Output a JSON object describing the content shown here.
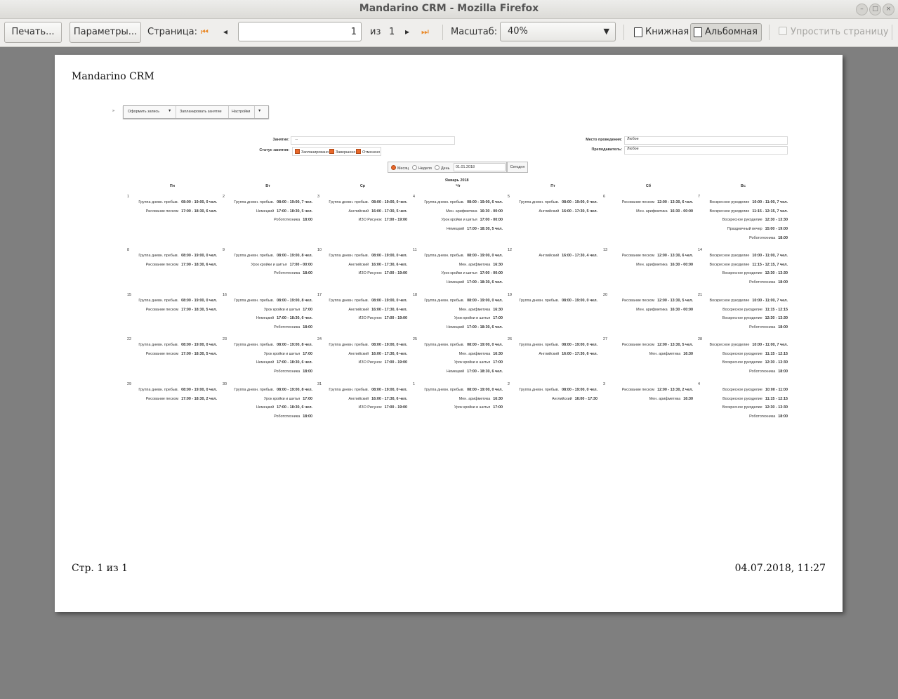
{
  "window": {
    "title": "Mandarino CRM - Mozilla Firefox"
  },
  "toolbar": {
    "print_label": "Печать...",
    "params_label": "Параметры...",
    "page_label": "Страница:",
    "page_value": "1",
    "of_label": "из",
    "total_pages": "1",
    "scale_label": "Масштаб:",
    "scale_value": "40%",
    "portrait_label": "Книжная",
    "landscape_label": "Альбомная",
    "simplify_label": "Упростить страницу",
    "active_orientation": "landscape"
  },
  "page": {
    "header": "Mandarino CRM",
    "footer_left": "Стр. 1 из 1",
    "footer_right": "04.07.2018, 11:27"
  },
  "crm": {
    "menu": {
      "back": "»",
      "create_record": "Оформить запись",
      "plan_lesson": "Запланировать занятие",
      "settings": "Настройки"
    },
    "filters": {
      "lesson_label": "Занятие:",
      "lesson_value": "...",
      "status_label": "Статус занятия:",
      "statuses": [
        "Запланировано",
        "Завершено",
        "Отменено"
      ],
      "place_label": "Место проведения:",
      "place_value": "Любое",
      "teacher_label": "Преподаватель:",
      "teacher_value": "Любое"
    },
    "view": {
      "month": "Месяц",
      "week": "Неделя",
      "day": "День",
      "date": "01.01.2018",
      "today": "Сегодня"
    },
    "calendar": {
      "month_title": "Январь 2018",
      "weekdays": [
        "Пн",
        "Вт",
        "Ср",
        "Чт",
        "Пт",
        "Сб",
        "Вс"
      ],
      "weeks": [
        [
          {
            "d": "1",
            "ev": [
              [
                "Группа дневн. пребыв.",
                "08:00 - 19:00, 0 чел."
              ],
              [
                "Рисование песком",
                "17:00 - 18:30, 6 чел."
              ]
            ]
          },
          {
            "d": "2",
            "ev": [
              [
                "Группа дневн. пребыв.",
                "08:00 - 19:00, 7 чел."
              ],
              [
                "Немецкий",
                "17:00 - 18:30, 5 чел."
              ],
              [
                "Робототехника",
                "18:00"
              ]
            ]
          },
          {
            "d": "3",
            "ev": [
              [
                "Группа дневн. пребыв.",
                "08:00 - 19:00, 0 чел."
              ],
              [
                "Английский",
                "16:00 - 17:30, 5 чел."
              ],
              [
                "ИЗО Рисунок",
                "17:00 - 19:00"
              ]
            ]
          },
          {
            "d": "4",
            "ev": [
              [
                "Группа дневн. пребыв.",
                "08:00 - 19:00, 6 чел."
              ],
              [
                "Мен. арифметика",
                "16:30 - 00:00"
              ],
              [
                "Урок кройки и шитья",
                "17:00 - 00:00"
              ],
              [
                "Немецкий",
                "17:00 - 18:30, 5 чел."
              ]
            ]
          },
          {
            "d": "5",
            "ev": [
              [
                "Группа дневн. пребыв.",
                "08:00 - 19:00, 0 чел."
              ],
              [
                "Английский",
                "16:00 - 17:30, 5 чел."
              ]
            ]
          },
          {
            "d": "6",
            "ev": [
              [
                "Рисование песком",
                "12:00 - 13:30, 6 чел."
              ],
              [
                "Мен. арифметика",
                "16:30 - 00:00"
              ]
            ]
          },
          {
            "d": "7",
            "ev": [
              [
                "Воскресное рукоделие",
                "10:00 - 11:00, 7 чел."
              ],
              [
                "Воскресное рукоделие",
                "11:15 - 12:15, 7 чел."
              ],
              [
                "Воскресное рукоделие",
                "12:30 - 13:30"
              ],
              [
                "Праздничный вечер",
                "15:00 - 19:00"
              ],
              [
                "Робототехника",
                "18:00"
              ]
            ]
          }
        ],
        [
          {
            "d": "8",
            "ev": [
              [
                "Группа дневн. пребыв.",
                "08:00 - 19:00, 0 чел."
              ],
              [
                "Рисование песком",
                "17:00 - 18:30, 6 чел."
              ]
            ]
          },
          {
            "d": "9",
            "ev": [
              [
                "Группа дневн. пребыв.",
                "08:00 - 19:00, 8 чел."
              ],
              [
                "Урок кройки и шитья",
                "17:00 - 00:00"
              ],
              [
                "Робототехника",
                "18:00"
              ]
            ]
          },
          {
            "d": "10",
            "ev": [
              [
                "Группа дневн. пребыв.",
                "08:00 - 19:00, 0 чел."
              ],
              [
                "Английский",
                "16:00 - 17:30, 6 чел."
              ],
              [
                "ИЗО Рисунок",
                "17:00 - 19:00"
              ]
            ]
          },
          {
            "d": "11",
            "ev": [
              [
                "Группа дневн. пребыв.",
                "08:00 - 19:00, 0 чел."
              ],
              [
                "Мен. арифметика",
                "16:30"
              ],
              [
                "Урок кройки и шитья",
                "17:00 - 00:00"
              ],
              [
                "Немецкий",
                "17:00 - 18:30, 6 чел."
              ]
            ]
          },
          {
            "d": "12",
            "ev": [
              [
                "Английский",
                "16:00 - 17:30, 4 чел."
              ]
            ]
          },
          {
            "d": "13",
            "ev": [
              [
                "Рисование песком",
                "12:00 - 13:30, 6 чел."
              ],
              [
                "Мен. арифметика",
                "16:30 - 00:00"
              ]
            ]
          },
          {
            "d": "14",
            "ev": [
              [
                "Воскресное рукоделие",
                "10:00 - 11:00, 7 чел."
              ],
              [
                "Воскресное рукоделие",
                "11:15 - 12:15, 7 чел."
              ],
              [
                "Воскресное рукоделие",
                "12:30 - 13:30"
              ],
              [
                "Робототехника",
                "18:00"
              ]
            ]
          }
        ],
        [
          {
            "d": "15",
            "ev": [
              [
                "Группа дневн. пребыв.",
                "08:00 - 19:00, 0 чел."
              ],
              [
                "Рисование песком",
                "17:00 - 18:30, 5 чел."
              ]
            ]
          },
          {
            "d": "16",
            "ev": [
              [
                "Группа дневн. пребыв.",
                "08:00 - 19:00, 8 чел."
              ],
              [
                "Урок кройки и шитья",
                "17:00"
              ],
              [
                "Немецкий",
                "17:00 - 18:30, 6 чел."
              ],
              [
                "Робототехника",
                "18:00"
              ]
            ]
          },
          {
            "d": "17",
            "ev": [
              [
                "Группа дневн. пребыв.",
                "08:00 - 19:00, 0 чел."
              ],
              [
                "Английский",
                "16:00 - 17:30, 6 чел."
              ],
              [
                "ИЗО Рисунок",
                "17:00 - 19:00"
              ]
            ]
          },
          {
            "d": "18",
            "ev": [
              [
                "Группа дневн. пребыв.",
                "08:00 - 19:00, 0 чел."
              ],
              [
                "Мен. арифметика",
                "16:30"
              ],
              [
                "Урок кройки и шитья",
                "17:00"
              ],
              [
                "Немецкий",
                "17:00 - 18:30, 6 чел."
              ]
            ]
          },
          {
            "d": "19",
            "ev": [
              [
                "Группа дневн. пребыв.",
                "08:00 - 19:00, 0 чел."
              ]
            ]
          },
          {
            "d": "20",
            "ev": [
              [
                "Рисование песком",
                "12:00 - 13:30, 5 чел."
              ],
              [
                "Мен. арифметика",
                "16:30 - 00:00"
              ]
            ]
          },
          {
            "d": "21",
            "ev": [
              [
                "Воскресное рукоделие",
                "10:00 - 11:00, 7 чел."
              ],
              [
                "Воскресное рукоделие",
                "11:15 - 12:15"
              ],
              [
                "Воскресное рукоделие",
                "12:30 - 13:30"
              ],
              [
                "Робототехника",
                "18:00"
              ]
            ]
          }
        ],
        [
          {
            "d": "22",
            "ev": [
              [
                "Группа дневн. пребыв.",
                "08:00 - 19:00, 0 чел."
              ],
              [
                "Рисование песком",
                "17:00 - 18:30, 5 чел."
              ]
            ]
          },
          {
            "d": "23",
            "ev": [
              [
                "Группа дневн. пребыв.",
                "08:00 - 19:00, 8 чел."
              ],
              [
                "Урок кройки и шитья",
                "17:00"
              ],
              [
                "Немецкий",
                "17:00 - 18:30, 6 чел."
              ],
              [
                "Робототехника",
                "18:00"
              ]
            ]
          },
          {
            "d": "24",
            "ev": [
              [
                "Группа дневн. пребыв.",
                "08:00 - 19:00, 0 чел."
              ],
              [
                "Английский",
                "16:00 - 17:30, 6 чел."
              ],
              [
                "ИЗО Рисунок",
                "17:00 - 19:00"
              ]
            ]
          },
          {
            "d": "25",
            "ev": [
              [
                "Группа дневн. пребыв.",
                "08:00 - 19:00, 0 чел."
              ],
              [
                "Мен. арифметика",
                "16:30"
              ],
              [
                "Урок кройки и шитья",
                "17:00"
              ],
              [
                "Немецкий",
                "17:00 - 18:30, 6 чел."
              ]
            ]
          },
          {
            "d": "26",
            "ev": [
              [
                "Группа дневн. пребыв.",
                "08:00 - 19:00, 0 чел."
              ],
              [
                "Английский",
                "16:00 - 17:30, 6 чел."
              ]
            ]
          },
          {
            "d": "27",
            "ev": [
              [
                "Рисование песком",
                "12:00 - 13:30, 5 чел."
              ],
              [
                "Мен. арифметика",
                "16:30"
              ]
            ]
          },
          {
            "d": "28",
            "ev": [
              [
                "Воскресное рукоделие",
                "10:00 - 11:00, 7 чел."
              ],
              [
                "Воскресное рукоделие",
                "11:15 - 12:15"
              ],
              [
                "Воскресное рукоделие",
                "12:30 - 13:30"
              ],
              [
                "Робототехника",
                "18:00"
              ]
            ]
          }
        ],
        [
          {
            "d": "29",
            "ev": [
              [
                "Группа дневн. пребыв.",
                "08:00 - 19:00, 0 чел."
              ],
              [
                "Рисование песком",
                "17:00 - 18:30, 2 чел."
              ]
            ]
          },
          {
            "d": "30",
            "ev": [
              [
                "Группа дневн. пребыв.",
                "08:00 - 19:00, 8 чел."
              ],
              [
                "Урок кройки и шитья",
                "17:00"
              ],
              [
                "Немецкий",
                "17:00 - 18:30, 6 чел."
              ],
              [
                "Робототехника",
                "18:00"
              ]
            ]
          },
          {
            "d": "31",
            "ev": [
              [
                "Группа дневн. пребыв.",
                "08:00 - 19:00, 0 чел."
              ],
              [
                "Английский",
                "16:00 - 17:30, 6 чел."
              ],
              [
                "ИЗО Рисунок",
                "17:00 - 19:00"
              ]
            ]
          },
          {
            "d": "1",
            "ev": [
              [
                "Группа дневн. пребыв.",
                "08:00 - 19:00, 0 чел."
              ],
              [
                "Мен. арифметика",
                "16:30"
              ],
              [
                "Урок кройки и шитья",
                "17:00"
              ]
            ]
          },
          {
            "d": "2",
            "ev": [
              [
                "Группа дневн. пребыв.",
                "08:00 - 19:00, 0 чел."
              ],
              [
                "Английский",
                "16:00 - 17:30"
              ]
            ]
          },
          {
            "d": "3",
            "ev": [
              [
                "Рисование песком",
                "12:00 - 13:30, 2 чел."
              ],
              [
                "Мен. арифметика",
                "16:30"
              ]
            ]
          },
          {
            "d": "4",
            "ev": [
              [
                "Воскресное рукоделие",
                "10:00 - 11:00"
              ],
              [
                "Воскресное рукоделие",
                "11:15 - 12:15"
              ],
              [
                "Воскресное рукоделие",
                "12:30 - 13:30"
              ],
              [
                "Робототехника",
                "18:00"
              ]
            ]
          }
        ]
      ]
    }
  }
}
